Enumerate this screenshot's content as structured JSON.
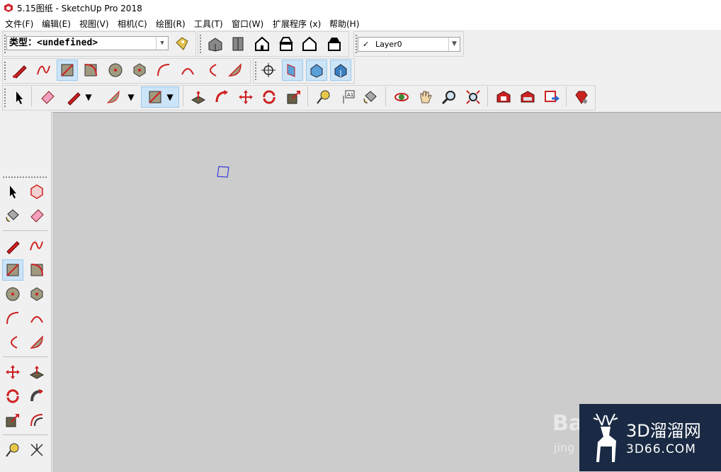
{
  "window": {
    "title": "5.15图纸 - SketchUp Pro 2018"
  },
  "menu": [
    "文件(F)",
    "编辑(E)",
    "视图(V)",
    "相机(C)",
    "绘图(R)",
    "工具(T)",
    "窗口(W)",
    "扩展程序 (x)",
    "帮助(H)"
  ],
  "type_selector": {
    "value": "类型：<undefined>"
  },
  "layer_selector": {
    "check": "✓",
    "value": "Layer0"
  },
  "watermark": {
    "brand": "3D溜溜网",
    "domain": "3D66.COM",
    "ghost_text": "Ba",
    "ghost_sub": "jing"
  },
  "colors": {
    "accent_red": "#d4202a",
    "active_bg": "#cce4f7",
    "viewport_bg": "#cccccc",
    "watermark_bg": "#1a2a44"
  }
}
